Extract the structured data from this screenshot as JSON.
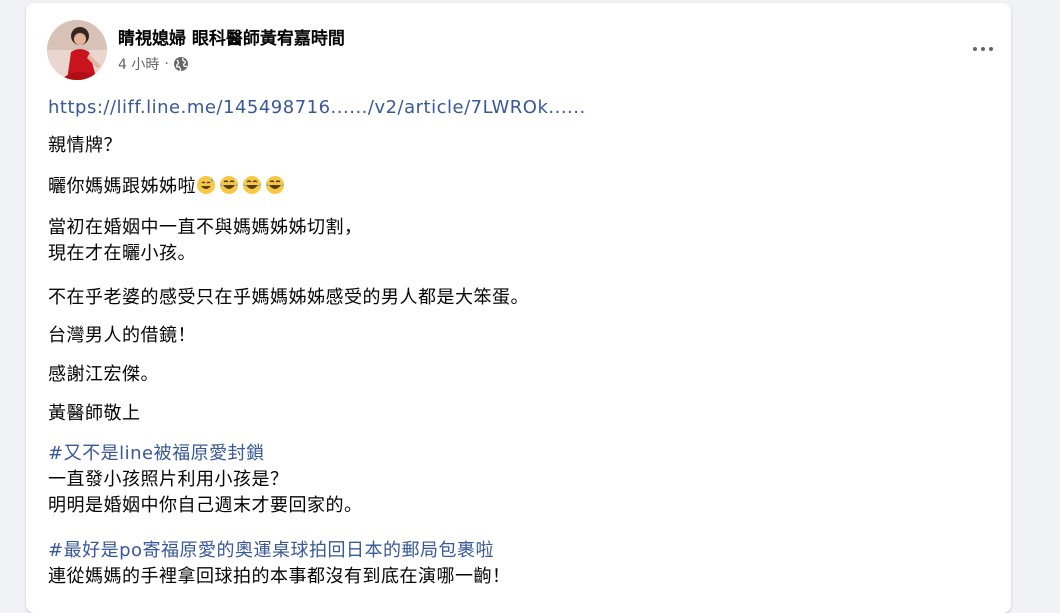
{
  "post": {
    "author": "睛視媳婦 眼科醫師黃宥嘉時間",
    "time": "4 小時",
    "separator": "·",
    "privacy_icon": "globe-icon",
    "more_icon": "more-options-icon",
    "link": "https://liff.line.me/145498716....../v2/article/7LWROk......",
    "paragraphs": {
      "p1": "親情牌？",
      "p2_text": "曬你媽媽跟姊姊啦",
      "p2_emojis": [
        "grinning-sweat-face-emoji",
        "joy-face-emoji",
        "joy-face-emoji",
        "joy-face-emoji"
      ],
      "p3_line1": "當初在婚姻中一直不與媽媽姊姊切割，",
      "p3_line2": "現在才在曬小孩。",
      "p4": "不在乎老婆的感受只在乎媽媽姊姊感受的男人都是大笨蛋。",
      "p5": "台灣男人的借鏡！",
      "p6": "感謝江宏傑。",
      "p7": "黃醫師敬上",
      "hashtag1": "#又不是line被福原愛封鎖",
      "p8_line1": "一直發小孩照片利用小孩是？",
      "p8_line2": "明明是婚姻中你自己週末才要回家的。",
      "hashtag2": "#最好是po寄福原愛的奧運桌球拍回日本的郵局包裹啦",
      "p9_line1": "連從媽媽的手裡拿回球拍的本事都沒有到底在演哪一齣！"
    }
  },
  "colors": {
    "link": "#385898",
    "secondary_text": "#65676b",
    "card_bg": "#ffffff",
    "page_bg": "#f0f2f5"
  }
}
